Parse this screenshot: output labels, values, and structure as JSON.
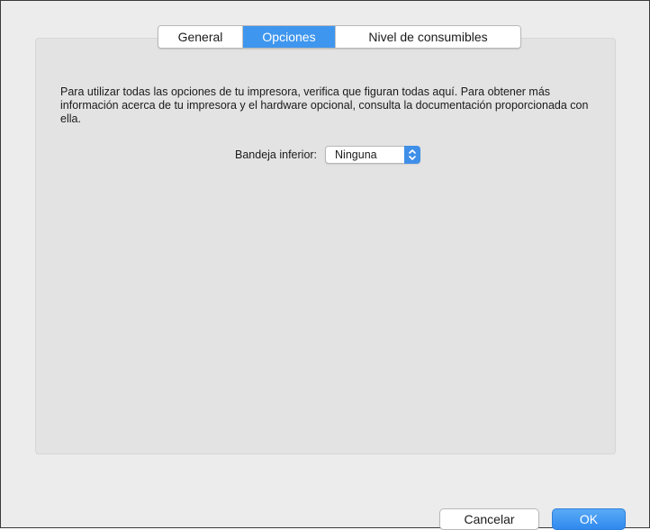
{
  "tabs": [
    {
      "label": "General",
      "selected": false
    },
    {
      "label": "Opciones",
      "selected": true
    },
    {
      "label": "Nivel de consumibles",
      "selected": false
    }
  ],
  "options": {
    "description": "Para utilizar todas las opciones de tu impresora, verifica que figuran todas aquí. Para obtener más información acerca de tu impresora y el hardware opcional, consulta la documentación proporcionada con ella.",
    "lower_tray_label": "Bandeja inferior:",
    "lower_tray_value": "Ninguna",
    "lower_tray_arrows_icon": "chevron-up-down-icon"
  },
  "buttons": {
    "cancel_label": "Cancelar",
    "ok_label": "OK"
  },
  "colors": {
    "accent": "#3f96ee",
    "panel_background": "#e3e3e3",
    "window_background": "#ececec"
  }
}
